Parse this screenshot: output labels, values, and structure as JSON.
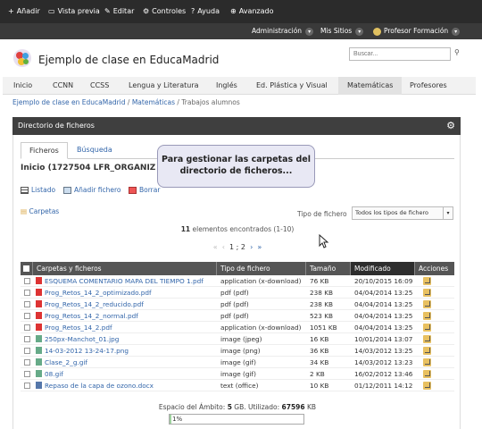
{
  "topbar": {
    "items": [
      {
        "icon": "plus-icon",
        "glyph": "+",
        "label": "Añadir"
      },
      {
        "icon": "monitor-icon",
        "glyph": "▭",
        "label": "Vista previa"
      },
      {
        "icon": "edit-icon",
        "glyph": "✎",
        "label": "Editar"
      },
      {
        "icon": "gear-icon",
        "glyph": "⚙",
        "label": "Controles"
      },
      {
        "icon": "help-icon",
        "glyph": "?",
        "label": "Ayuda"
      },
      {
        "icon": "plus-circle-icon",
        "glyph": "⊕",
        "label": "Avanzado"
      }
    ]
  },
  "adminbar": {
    "admin_label": "Administración",
    "sites_label": "Mis Sitios",
    "user_label": "Profesor Formación"
  },
  "header": {
    "site_title": "Ejemplo de clase en EducaMadrid",
    "search_placeholder": "Buscar..."
  },
  "nav": {
    "tabs": [
      "Inicio",
      "CCNN",
      "CCSS",
      "Lengua y Literatura",
      "Inglés",
      "Ed. Plástica y Visual",
      "Matemáticas",
      "Profesores"
    ],
    "active": "Matemáticas"
  },
  "breadcrumb": {
    "items": [
      "Ejemplo de clase en EducaMadrid",
      "Matemáticas",
      "Trabajos alumnos"
    ],
    "separator": "/"
  },
  "panel": {
    "title": "Directorio de ficheros",
    "subtabs": [
      "Ficheros",
      "Búsqueda"
    ],
    "folder_title": "Inicio (1727504 LFR_ORGANIZ",
    "toolbar": {
      "listado": "Listado",
      "anadir": "Añadir fichero",
      "borrar": "Borrar"
    },
    "folders_link": "Carpetas",
    "type_label": "Tipo de fichero",
    "type_select": "Todos los tipos de fichero",
    "count_number": "11",
    "count_text": "elementos encontrados (1-10)",
    "pager": {
      "first": "«",
      "prev": "‹",
      "current": "1",
      "sep": "2",
      "next": "›",
      "last": "»"
    }
  },
  "table": {
    "headers": [
      "Carpetas y ficheros",
      "Tipo de fichero",
      "Tamaño",
      "Modificado",
      "Acciones"
    ],
    "sorted_column": "Modificado",
    "rows": [
      {
        "name": "ESQUEMA COMENTARIO MAPA DEL TIEMPO 1.pdf",
        "type": "application (x-download)",
        "size": "76 KB",
        "modified": "20/10/2015 16:09",
        "icon": "pdf-icon"
      },
      {
        "name": "Prog_Retos_14_2_optimizado.pdf",
        "type": "pdf (pdf)",
        "size": "238 KB",
        "modified": "04/04/2014 13:25",
        "icon": "pdf-icon"
      },
      {
        "name": "Prog_Retos_14_2_reducido.pdf",
        "type": "pdf (pdf)",
        "size": "238 KB",
        "modified": "04/04/2014 13:25",
        "icon": "pdf-icon"
      },
      {
        "name": "Prog_Retos_14_2_normal.pdf",
        "type": "pdf (pdf)",
        "size": "523 KB",
        "modified": "04/04/2014 13:25",
        "icon": "pdf-icon"
      },
      {
        "name": "Prog_Retos_14_2.pdf",
        "type": "application (x-download)",
        "size": "1051 KB",
        "modified": "04/04/2014 13:25",
        "icon": "pdf-icon"
      },
      {
        "name": "250px-Manchot_01.jpg",
        "type": "image (jpeg)",
        "size": "16 KB",
        "modified": "10/01/2014 13:07",
        "icon": "image-icon"
      },
      {
        "name": "14-03-2012 13-24-17.png",
        "type": "image (png)",
        "size": "36 KB",
        "modified": "14/03/2012 13:25",
        "icon": "image-icon"
      },
      {
        "name": "Clase_2_g.gif",
        "type": "image (gif)",
        "size": "34 KB",
        "modified": "14/03/2012 13:23",
        "icon": "image-icon"
      },
      {
        "name": "08.gif",
        "type": "image (gif)",
        "size": "2 KB",
        "modified": "16/02/2012 13:46",
        "icon": "image-icon"
      },
      {
        "name": "Repaso de la capa de ozono.docx",
        "type": "text (office)",
        "size": "10 KB",
        "modified": "01/12/2011 14:12",
        "icon": "doc-icon"
      }
    ]
  },
  "storage": {
    "prefix": "Espacio del Ámbito:",
    "total": "5",
    "total_unit": "GB. Utilizado:",
    "used": "67596",
    "used_unit": "KB",
    "percent_label": "1%",
    "percent": 1
  },
  "callout": {
    "text": "Para gestionar las carpetas del directorio de ficheros..."
  },
  "colors": {
    "link": "#3366aa",
    "topbar": "#2b2b2b",
    "panel_head": "#3f3f3f",
    "progress": "#9fd29f"
  }
}
